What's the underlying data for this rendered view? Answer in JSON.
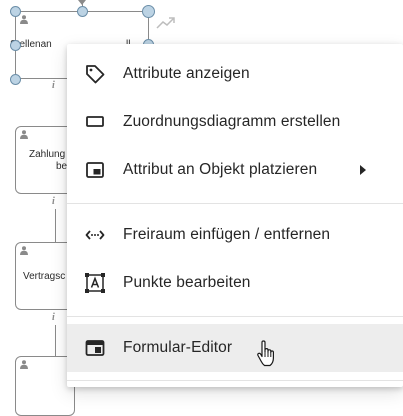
{
  "diagram": {
    "shape1_label": "Stellenan",
    "shape1_label_tail": "ll",
    "shape2_label_line1": "Zahlung",
    "shape2_label_line2": "be",
    "shape3_label": "Vertragsc",
    "info_glyph": "i"
  },
  "context_menu": {
    "items": [
      {
        "label": "Attribute anzeigen",
        "icon": "tag-icon"
      },
      {
        "label": "Zuordnungsdiagramm erstellen",
        "icon": "rectangle-icon"
      },
      {
        "label": "Attribut an Objekt platzieren",
        "icon": "place-attribute-icon",
        "has_submenu": true
      },
      {
        "label": "Freiraum einfügen / entfernen",
        "icon": "space-insert-icon"
      },
      {
        "label": "Punkte bearbeiten",
        "icon": "edit-points-icon"
      },
      {
        "label": "Formular-Editor",
        "icon": "form-editor-icon",
        "hovered": true
      }
    ]
  },
  "colors": {
    "menu_background": "#ffffff",
    "hover_background": "#ededed",
    "text": "#262626",
    "handle_fill": "#bcd3e4",
    "handle_stroke": "#6b8ea8"
  }
}
